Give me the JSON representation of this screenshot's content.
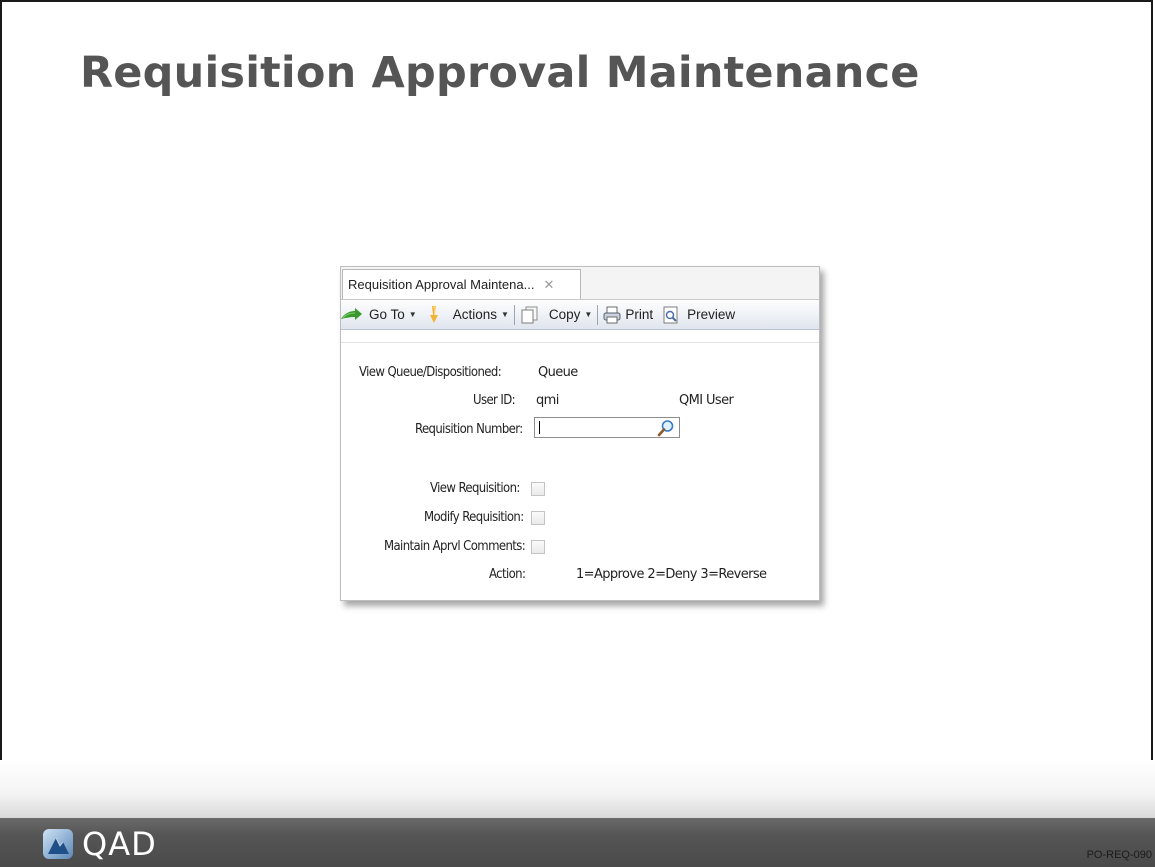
{
  "slide": {
    "title": "Requisition Approval Maintenance",
    "brand": "QAD",
    "code": "PO-REQ-090"
  },
  "window": {
    "tab_label": "Requisition Approval Maintena...",
    "tab_close": "✕"
  },
  "toolbar": {
    "goto_label": "Go To",
    "actions_label": "Actions",
    "copy_label": "Copy",
    "print_label": "Print",
    "preview_label": "Preview"
  },
  "form": {
    "view_queue_label": "View Queue/Dispositioned:",
    "view_queue_value": "Queue",
    "user_id_label": "User ID:",
    "user_id_value": "qmi",
    "user_name": "QMI User",
    "req_number_label": "Requisition Number:",
    "req_number_value": "",
    "view_req_label": "View Requisition:",
    "modify_req_label": "Modify Requisition:",
    "maintain_comments_label": "Maintain Aprvl Comments:",
    "action_label": "Action:",
    "action_hint": "1=Approve 2=Deny 3=Reverse"
  },
  "colors": {
    "title": "#555555",
    "footer": "#4f4f4f",
    "toolbar_border": "#b9c3d1"
  },
  "icons": [
    "goto-arrow-icon",
    "actions-icon",
    "copy-icon",
    "print-icon",
    "preview-icon",
    "search-icon",
    "qad-logo-icon",
    "close-icon"
  ]
}
